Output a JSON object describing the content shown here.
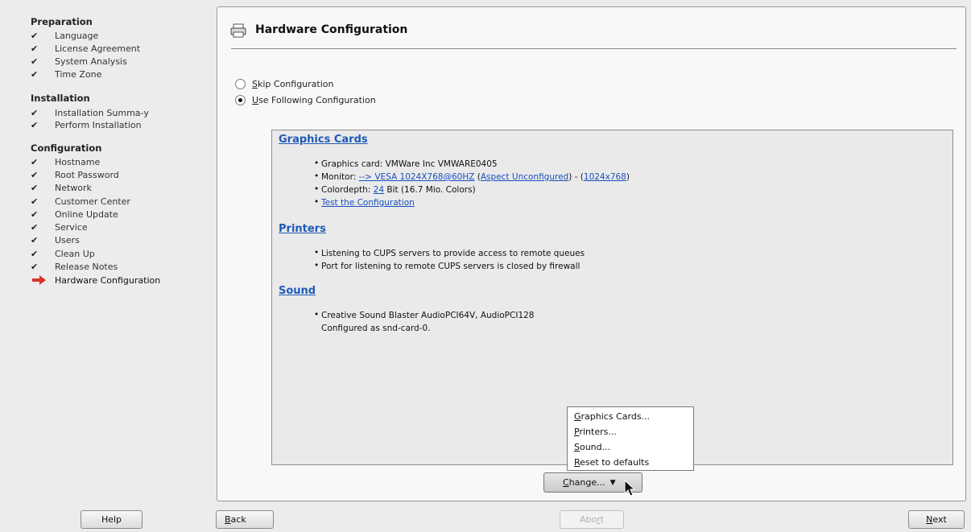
{
  "sidebar": {
    "sections": [
      {
        "title": "Preparation",
        "items": [
          "Language",
          "License Agreement",
          "System Analysis",
          "Time Zone"
        ]
      },
      {
        "title": "Installation",
        "items": [
          "Installation Summa-y",
          "Perform Installation"
        ]
      },
      {
        "title": "Configuration",
        "items": [
          "Hostname",
          "Root Password",
          "Network",
          "Customer Center",
          "Online Update",
          "Service",
          "Users",
          "Clean Up",
          "Release Notes",
          "Hardware Configuration"
        ]
      }
    ],
    "current_step": "Hardware Configuration",
    "check_icon": "checkmark-icon",
    "current_icon": "red-arrow-icon"
  },
  "header": {
    "title": "Hardware Configuration",
    "icon": "printer-icon"
  },
  "options": {
    "skip_label_first": "S",
    "skip_label_rest": "kip Configuration",
    "use_label_first": "U",
    "use_label_rest": "se Following Configuration",
    "selected": "use"
  },
  "summary": {
    "graphics": {
      "title": "Graphics Cards",
      "card": "Graphics card: VMWare Inc VMWARE0405",
      "monitor_prefix": "Monitor: ",
      "monitor_link": "--> VESA 1024X768@60HZ",
      "monitor_mid": " (",
      "aspect_link": "Aspect Unconfigured",
      "monitor_sep": ") - (",
      "res_link": "1024x768",
      "monitor_end": ")",
      "depth_prefix": "Colordepth: ",
      "depth_link": "24",
      "depth_suffix": " Bit (16.7 Mio. Colors)",
      "test_link": "Test the Configuration"
    },
    "printers": {
      "title": "Printers",
      "line1": "Listening to CUPS servers to provide access to remote queues",
      "line2": "Port for listening to remote CUPS servers is closed by firewall"
    },
    "sound": {
      "title": "Sound",
      "line1": "Creative Sound Blaster AudioPCI64V, AudioPCI128",
      "line2": "Configured as snd-card-0."
    }
  },
  "menu": {
    "graphics_first": "G",
    "graphics_rest": "raphics Cards...",
    "printers_first": "P",
    "printers_rest": "rinters...",
    "sound_first": "S",
    "sound_rest": "ound...",
    "reset_first": "R",
    "reset_rest": "eset to defaults"
  },
  "buttons": {
    "change_first": "C",
    "change_rest": "hange...",
    "help": "Help",
    "back_first": "B",
    "back_rest": "ack",
    "abort_pre": "Abo",
    "abort_u": "r",
    "abort_post": "t",
    "next_first": "N",
    "next_rest": "ext"
  },
  "colors": {
    "link": "#1a4fbf",
    "section_title": "#1f5ab8",
    "current_arrow": "#d9342b"
  }
}
